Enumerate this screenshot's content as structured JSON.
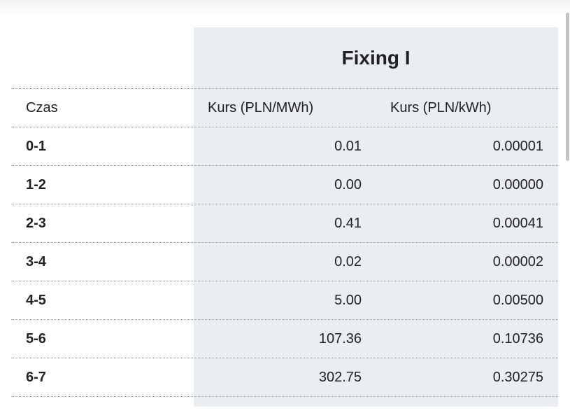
{
  "fixing": {
    "title": "Fixing I"
  },
  "table": {
    "headers": {
      "time": "Czas",
      "mwh": "Kurs (PLN/MWh)",
      "kwh": "Kurs (PLN/kWh)"
    },
    "rows": [
      {
        "time": "0-1",
        "mwh": "0.01",
        "kwh": "0.00001"
      },
      {
        "time": "1-2",
        "mwh": "0.00",
        "kwh": "0.00000"
      },
      {
        "time": "2-3",
        "mwh": "0.41",
        "kwh": "0.00041"
      },
      {
        "time": "3-4",
        "mwh": "0.02",
        "kwh": "0.00002"
      },
      {
        "time": "4-5",
        "mwh": "5.00",
        "kwh": "0.00500"
      },
      {
        "time": "5-6",
        "mwh": "107.36",
        "kwh": "0.10736"
      },
      {
        "time": "6-7",
        "mwh": "302.75",
        "kwh": "0.30275"
      }
    ]
  }
}
